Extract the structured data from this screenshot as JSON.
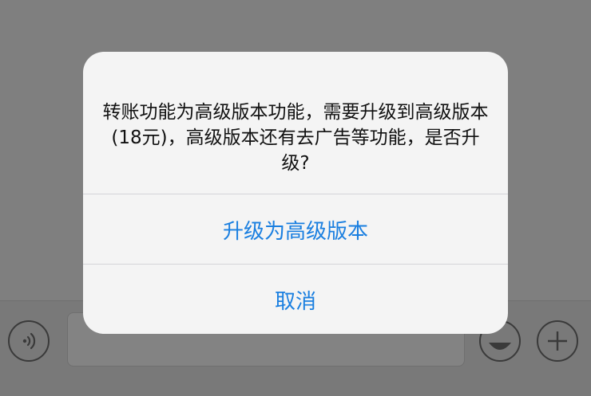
{
  "alert": {
    "message": "转账功能为高级版本功能，需要升级到高级版本(18元)，高级版本还有去广告等功能，是否升级?",
    "confirm_label": "升级为高级版本",
    "cancel_label": "取消"
  },
  "input_bar": {
    "voice_icon": "voice-icon",
    "emoji_icon": "emoji-icon",
    "plus_icon": "plus-icon"
  },
  "colors": {
    "accent": "#1a7fe0",
    "overlay": "#7f7f7f",
    "alert_bg": "#f4f4f4"
  }
}
